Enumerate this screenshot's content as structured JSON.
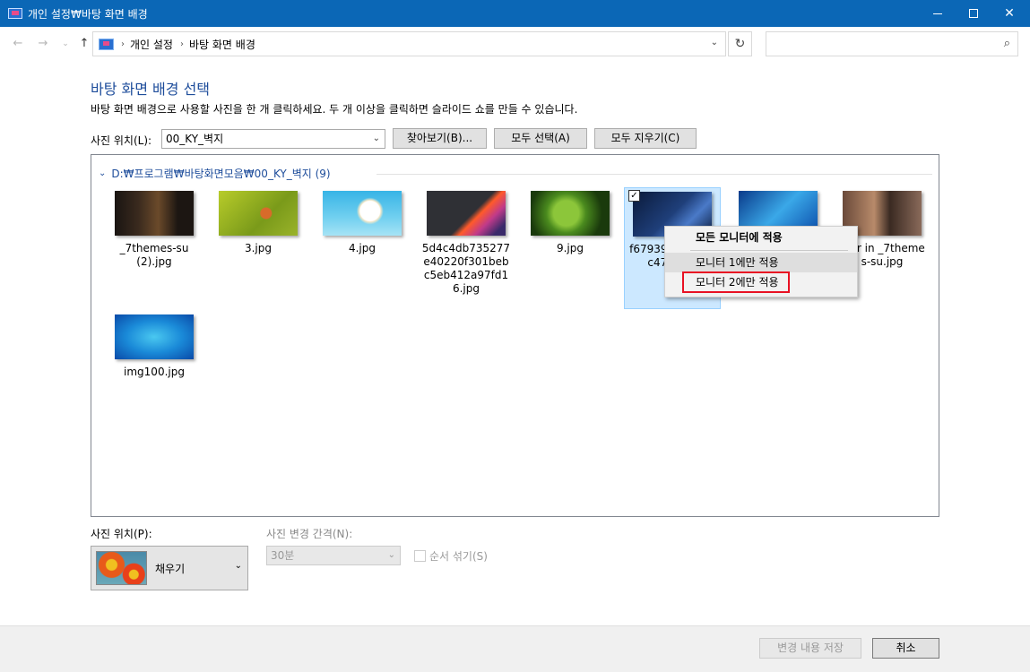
{
  "window": {
    "title": "개인 설정₩바탕 화면 배경"
  },
  "address": {
    "crumbs": [
      "개인 설정",
      "바탕 화면 배경"
    ],
    "search_placeholder": ""
  },
  "page": {
    "heading": "바탕 화면 배경 선택",
    "description": "바탕 화면 배경으로 사용할 사진을 한 개 클릭하세요. 두 개 이상을 클릭하면 슬라이드 쇼를 만들 수 있습니다.",
    "location_label": "사진 위치(L):",
    "location_value": "00_KY_벽지",
    "browse_label": "찾아보기(B)...",
    "select_all_label": "모두 선택(A)",
    "clear_all_label": "모두 지우기(C)"
  },
  "gallery": {
    "group_title": "D:₩프로그램₩바탕화면모음₩00_KY_벽지 (9)",
    "images": [
      {
        "name": "_7themes-su (2).jpg",
        "thumb": "t-dark"
      },
      {
        "name": "3.jpg",
        "thumb": "t-leaf"
      },
      {
        "name": "4.jpg",
        "thumb": "t-flower"
      },
      {
        "name": "5d4c4db735277e40220f301bebc5eb412a97fd16.jpg",
        "thumb": "t-abstract"
      },
      {
        "name": "9.jpg",
        "thumb": "t-green"
      },
      {
        "name": "f67939 936dd dc471c pg",
        "thumb": "t-space",
        "selected": true
      },
      {
        "name": "",
        "thumb": "t-blue"
      },
      {
        "name": "Hair in _7themes-su.jpg",
        "thumb": "t-portrait"
      },
      {
        "name": "img100.jpg",
        "thumb": "t-img100"
      }
    ]
  },
  "context_menu": {
    "items": [
      "모든 모니터에 적용",
      "모니터 1에만 적용",
      "모니터 2에만 적용"
    ]
  },
  "bottom": {
    "position_label": "사진 위치(P):",
    "position_value": "채우기",
    "interval_label": "사진 변경 간격(N):",
    "interval_value": "30분",
    "shuffle_label": "순서 섞기(S)"
  },
  "footer": {
    "save_label": "변경 내용 저장",
    "cancel_label": "취소"
  }
}
